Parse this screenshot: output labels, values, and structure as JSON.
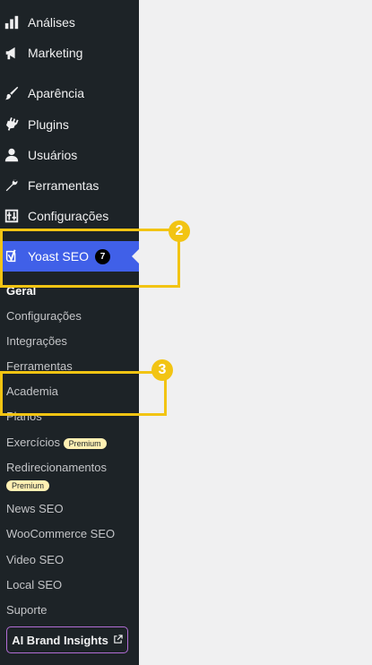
{
  "menu": {
    "items": [
      {
        "label": "Análises",
        "icon": "bar-chart-icon"
      },
      {
        "label": "Marketing",
        "icon": "megaphone-icon"
      },
      {
        "label": "Aparência",
        "icon": "paintbrush-icon"
      },
      {
        "label": "Plugins",
        "icon": "plug-icon"
      },
      {
        "label": "Usuários",
        "icon": "user-icon"
      },
      {
        "label": "Ferramentas",
        "icon": "wrench-icon"
      },
      {
        "label": "Configurações",
        "icon": "settings-sliders-icon"
      }
    ],
    "yoast": {
      "label": "Yoast SEO",
      "badge": "7",
      "icon": "yoast-logo-icon"
    }
  },
  "submenu": {
    "items": [
      "Geral",
      "Configurações",
      "Integrações",
      "Ferramentas",
      "Academia",
      "Planos",
      "Exercícios",
      "Redirecionamentos",
      "News SEO",
      "WooCommerce SEO",
      "Video SEO",
      "Local SEO",
      "Suporte"
    ],
    "premium_label": "Premium",
    "ai_button": "AI Brand Insights"
  },
  "callouts": [
    "2",
    "3"
  ],
  "colors": {
    "sidebar_bg": "#1d2327",
    "active_bg": "#4060e8",
    "callout": "#f2c413",
    "premium_bg": "#fff0b3"
  }
}
